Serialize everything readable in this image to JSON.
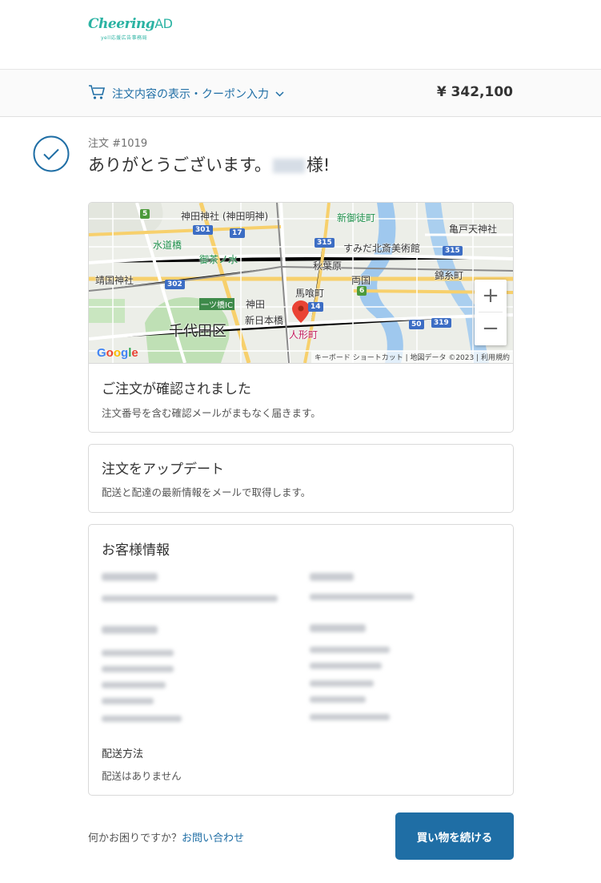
{
  "header": {
    "logo_text": "Cheering",
    "logo_text_ad": "AD",
    "logo_subtitle": "yell応援広告事務局"
  },
  "summary": {
    "toggle_label": "注文内容の表示・クーポン入力",
    "total": "¥ 342,100"
  },
  "order": {
    "number": "注文 #1019",
    "thanks_prefix": "ありがとうございます。",
    "thanks_suffix": "様!"
  },
  "map": {
    "zoom_in": "+",
    "zoom_out": "−",
    "attribution": "キーボード ショートカット | 地図データ ©2023 | 利用規約",
    "google": "Google",
    "labels": {
      "chiyoda": "千代田区",
      "kanda_jinja": "神田神社 (神田明神)",
      "akihabara": "秋葉原",
      "suidobashi": "水道橋",
      "ochanomizu": "御茶ノ水",
      "yasukuni": "靖国神社",
      "kanda": "神田",
      "shin_nihombashi": "新日本橋",
      "ningyocho": "人形町",
      "bakurocho": "馬喰町",
      "ryogoku": "両国",
      "sumida": "すみだ北斎美術館",
      "kinshicho": "錦糸町",
      "kameido": "亀戸天神社",
      "shin_okachimachi": "新御徒町",
      "hitotsubashi": "一ツ橋IC"
    }
  },
  "confirmed": {
    "title": "ご注文が確認されました",
    "text": "注文番号を含む確認メールがまもなく届きます。"
  },
  "update": {
    "title": "注文をアップデート",
    "text": "配送と配達の最新情報をメールで取得します。"
  },
  "customer": {
    "title": "お客様情報",
    "shipping_method_label": "配送方法",
    "shipping_method_value": "配送はありません"
  },
  "footer": {
    "help_text": "何かお困りですか？",
    "contact_link": "お問い合わせ",
    "continue_button": "買い物を続ける"
  },
  "colors": {
    "accent": "#1f6ea5",
    "brand": "#2bb3a3",
    "check": "#1f6ea5"
  }
}
